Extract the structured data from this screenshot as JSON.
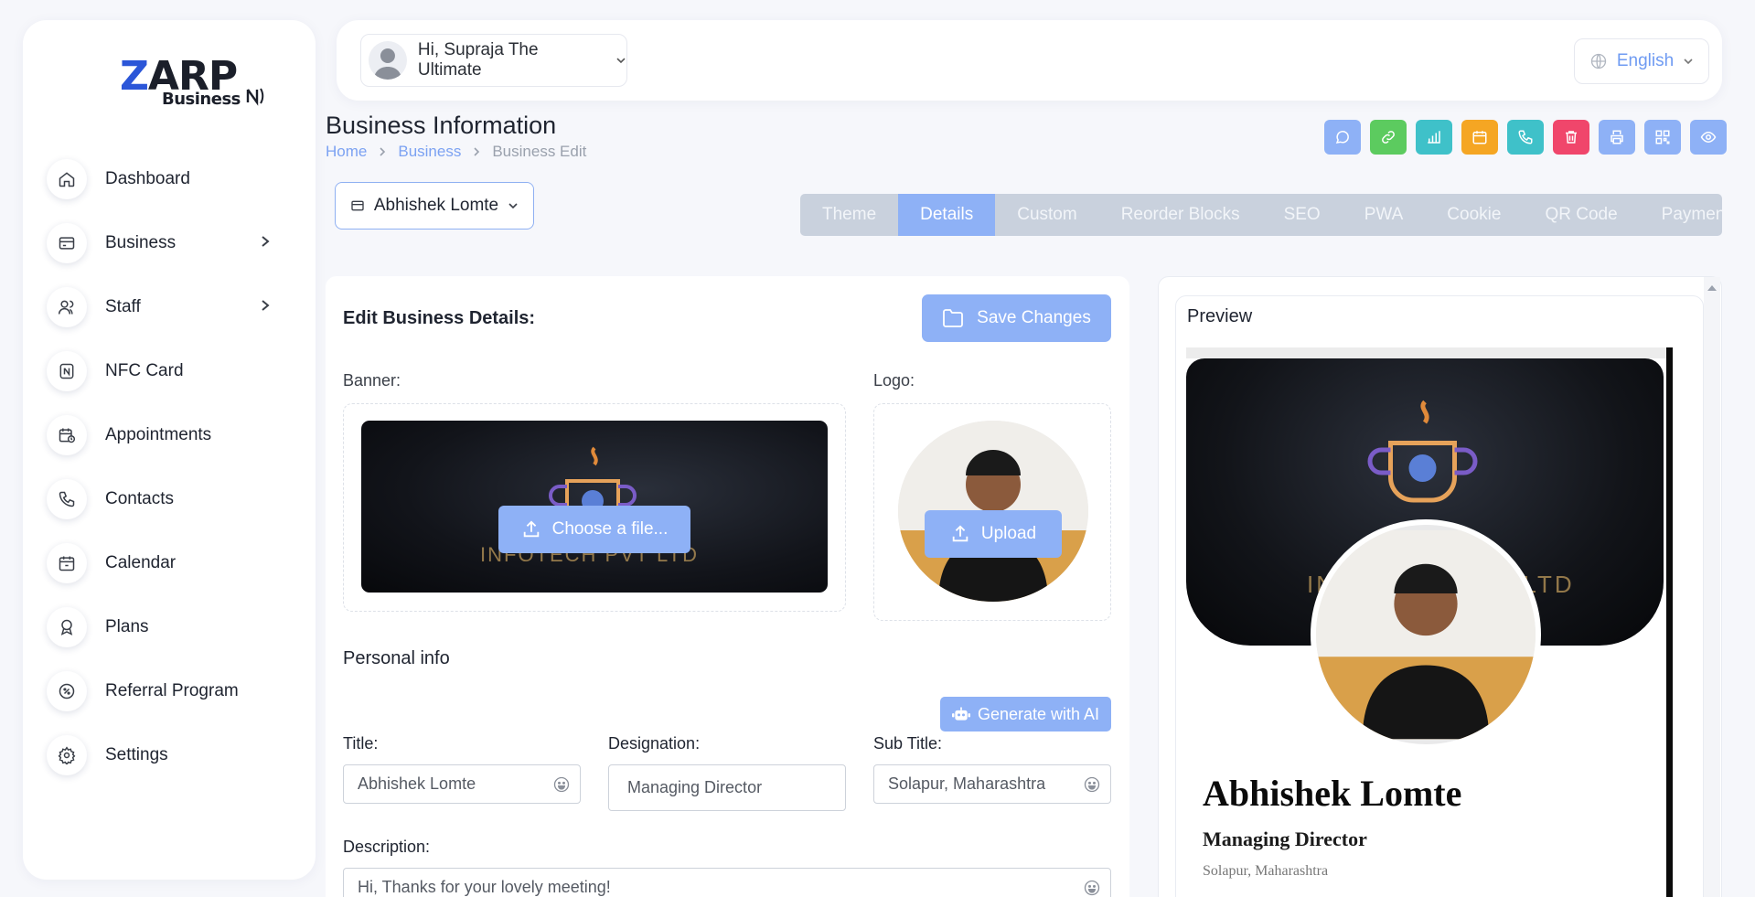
{
  "brand": {
    "logo_z": "Z",
    "logo_rest": "ARP",
    "logo_sub": "Business"
  },
  "sidebar": {
    "items": [
      {
        "label": "Dashboard",
        "icon": "home-icon"
      },
      {
        "label": "Business",
        "icon": "card-icon",
        "has_submenu": true
      },
      {
        "label": "Staff",
        "icon": "users-icon",
        "has_submenu": true
      },
      {
        "label": "NFC Card",
        "icon": "nfc-icon"
      },
      {
        "label": "Appointments",
        "icon": "calendar-clock-icon"
      },
      {
        "label": "Contacts",
        "icon": "phone-icon"
      },
      {
        "label": "Calendar",
        "icon": "calendar-icon"
      },
      {
        "label": "Plans",
        "icon": "award-icon"
      },
      {
        "label": "Referral Program",
        "icon": "badge-percent-icon"
      },
      {
        "label": "Settings",
        "icon": "gear-icon"
      }
    ]
  },
  "header": {
    "greeting": "Hi, Supraja The Ultimate",
    "language": "English"
  },
  "page": {
    "title": "Business Information",
    "breadcrumb": [
      "Home",
      "Business",
      "Business Edit"
    ],
    "business_selector": "Abhishek Lomte"
  },
  "actions": [
    {
      "name": "whatsapp",
      "color": "#8eb1f6"
    },
    {
      "name": "link",
      "color": "#5ccb5f"
    },
    {
      "name": "analytics",
      "color": "#3fc1c9"
    },
    {
      "name": "calendar",
      "color": "#f5a623"
    },
    {
      "name": "phone",
      "color": "#3fc1c9"
    },
    {
      "name": "delete",
      "color": "#f0466b"
    },
    {
      "name": "print",
      "color": "#8eb1f6"
    },
    {
      "name": "qr-code",
      "color": "#8eb1f6"
    },
    {
      "name": "view",
      "color": "#8eb1f6"
    }
  ],
  "tabs": [
    {
      "label": "Theme",
      "active": false
    },
    {
      "label": "Details",
      "active": true
    },
    {
      "label": "Custom",
      "active": false
    },
    {
      "label": "Reorder Blocks",
      "active": false
    },
    {
      "label": "SEO",
      "active": false
    },
    {
      "label": "PWA",
      "active": false
    },
    {
      "label": "Cookie",
      "active": false
    },
    {
      "label": "QR Code",
      "active": false
    },
    {
      "label": "Payment",
      "active": false
    }
  ],
  "edit": {
    "heading": "Edit Business Details:",
    "save_label": "Save Changes",
    "banner_label": "Banner:",
    "logo_label": "Logo:",
    "banner_button": "Choose a file...",
    "logo_button": "Upload",
    "banner_watermark": "INFOTECH PVT LTD",
    "section_personal": "Personal info",
    "ai_button": "Generate with AI",
    "fields": {
      "title_label": "Title:",
      "title_value": "Abhishek Lomte",
      "designation_label": "Designation:",
      "designation_value": "Managing Director",
      "subtitle_label": "Sub Title:",
      "subtitle_value": "Solapur, Maharashtra",
      "description_label": "Description:",
      "description_value": "Hi, Thanks for your lovely meeting!"
    }
  },
  "preview": {
    "title": "Preview",
    "banner_watermark": "INFOTECH PVT LTD",
    "name": "Abhishek Lomte",
    "designation": "Managing Director",
    "subtitle": "Solapur, Maharashtra"
  },
  "colors": {
    "accent": "#8eb1f6",
    "link": "#7ca2f2",
    "tab_bg": "#c9d1dd"
  }
}
